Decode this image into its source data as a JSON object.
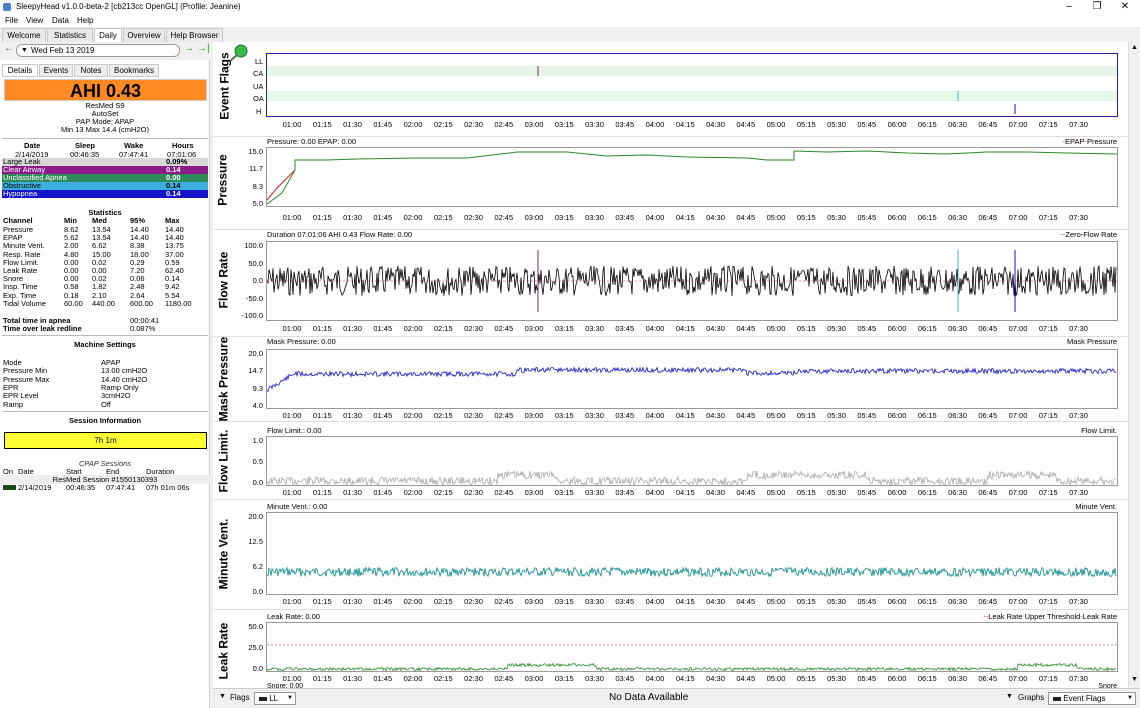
{
  "window": {
    "title": "SleepyHead v1.0.0-beta-2 [cb213cc OpenGL] (Profile: Jeanine)"
  },
  "menu": [
    "File",
    "View",
    "Data",
    "Help"
  ],
  "tabs": [
    "Welcome",
    "Statistics",
    "Daily",
    "Overview",
    "Help Browser"
  ],
  "date": "Wed Feb 13 2019",
  "subtabs": [
    "Details",
    "Events",
    "Notes",
    "Bookmarks"
  ],
  "ahi": "AHI 0.43",
  "machine": {
    "model": "ResMed S9",
    "mode_name": "AutoSet",
    "pap_mode": "PAP Mode: APAP",
    "pressure_range": "Min 13 Max 14.4 (cmH2O)"
  },
  "summary": {
    "headers": [
      "Date",
      "Sleep",
      "Wake",
      "Hours"
    ],
    "values": [
      "2/14/2019",
      "00:46:35",
      "07:47:41",
      "07:01:06"
    ]
  },
  "events": [
    {
      "name": "Large Leak",
      "value": "0.09%",
      "color": "#d8d8d8"
    },
    {
      "name": "Clear Airway",
      "value": "0.14",
      "color": "#8b1a8b"
    },
    {
      "name": "Unclassified Apnea",
      "value": "0.00",
      "color": "#2e8b57"
    },
    {
      "name": "Obstructive",
      "value": "0.14",
      "color": "#3bb0e0"
    },
    {
      "name": "Hypopnea",
      "value": "0.14",
      "color": "#1414c8"
    }
  ],
  "statistics": {
    "title": "Statistics",
    "headers": [
      "Channel",
      "Min",
      "Med",
      "95%",
      "Max"
    ],
    "rows": [
      [
        "Pressure",
        "8.62",
        "13.54",
        "14.40",
        "14.40"
      ],
      [
        "EPAP",
        "5.62",
        "13.54",
        "14.40",
        "14.40"
      ],
      [
        "Minute Vent.",
        "2.00",
        "6.62",
        "8.38",
        "13.75"
      ],
      [
        "Resp. Rate",
        "4.80",
        "15.00",
        "18.00",
        "37.00"
      ],
      [
        "Flow Limit.",
        "0.00",
        "0.02",
        "0.29",
        "0.59"
      ],
      [
        "Leak Rate",
        "0.00",
        "0.00",
        "7.20",
        "62.40"
      ],
      [
        "Snore",
        "0.00",
        "0.02",
        "0.06",
        "0.14"
      ],
      [
        "Insp. Time",
        "0.58",
        "1.82",
        "2.48",
        "9.42"
      ],
      [
        "Exp. Time",
        "0.18",
        "2.10",
        "2.64",
        "5.54"
      ],
      [
        "Tidal Volume",
        "60.00",
        "440.00",
        "600.00",
        "1180.00"
      ]
    ]
  },
  "apnea_time": {
    "label": "Total time in apnea",
    "value": "00:00:41"
  },
  "leak_time": {
    "label": "Time over leak redline",
    "value": "0.087%"
  },
  "machine_settings": {
    "title": "Machine Settings",
    "rows": [
      [
        "Mode",
        "APAP"
      ],
      [
        "Pressure Min",
        "13.00 cmH2O"
      ],
      [
        "Pressure Max",
        "14.40 cmH2O"
      ],
      [
        "EPR",
        "Ramp Only"
      ],
      [
        "EPR Level",
        "3cmH2O"
      ],
      [
        "Ramp",
        "Off"
      ]
    ]
  },
  "session_info": {
    "title": "Session Information",
    "duration": "7h 1m",
    "cpap_title": "CPAP Sessions",
    "headers": [
      "On",
      "Date",
      "Start",
      "End",
      "Duration"
    ],
    "session_name": "ResMed Session #1550130393",
    "row": [
      "2/14/2019",
      "00:46:35",
      "07:47:41",
      "07h 01m 06s"
    ]
  },
  "time_ticks": [
    "01:00",
    "01:15",
    "01:30",
    "01:45",
    "02:00",
    "02:15",
    "02:30",
    "02:45",
    "03:00",
    "03:15",
    "03:30",
    "03:45",
    "04:00",
    "04:15",
    "04:30",
    "04:45",
    "05:00",
    "05:15",
    "05:30",
    "05:45",
    "06:00",
    "06:15",
    "06:30",
    "06:45",
    "07:00",
    "07:15",
    "07:30"
  ],
  "graphs": {
    "event_flags": {
      "label": "Event Flags",
      "rows": [
        "LL",
        "CA",
        "UA",
        "OA",
        "H"
      ]
    },
    "pressure": {
      "label": "Pressure",
      "title": "Pressure: 0.00 EPAP: 0.00",
      "legend": "EPAP Pressure",
      "legend_a": "EPAP",
      "legend_b": "Pressure",
      "yticks": [
        "15.0",
        "11.7",
        "8.3",
        "5.0"
      ]
    },
    "flow_rate": {
      "label": "Flow Rate",
      "title": "Duration 07:01:06 AHI 0.43 Flow Rate: 0.00",
      "legend_a": "Zero",
      "legend_b": "Flow Rate",
      "yticks": [
        "100.0",
        "50.0",
        "0.0",
        "-50.0",
        "-100.0"
      ]
    },
    "mask_pressure": {
      "label": "Mask Pressure",
      "title": "Mask Pressure: 0.00",
      "legend": "Mask Pressure",
      "yticks": [
        "20.0",
        "14.7",
        "9.3",
        "4.0"
      ]
    },
    "flow_limit": {
      "label": "Flow Limit.",
      "title": "Flow Limit.: 0.00",
      "legend": "Flow Limit.",
      "yticks": [
        "1.0",
        "0.5",
        "0.0"
      ]
    },
    "minute_vent": {
      "label": "Minute Vent.",
      "title": "Minute Vent.: 0.00",
      "legend": "Minute Vent.",
      "yticks": [
        "20.0",
        "12.5",
        "6.2",
        "0.0"
      ]
    },
    "leak_rate": {
      "label": "Leak Rate",
      "title": "Leak Rate: 0.00",
      "legend_a": "Leak Rate Upper Threshold",
      "legend_b": "Leak Rate",
      "yticks": [
        "50.0",
        "25.0",
        "0.0"
      ]
    },
    "snore": {
      "title": "Snore: 0.00",
      "legend": "Snore"
    }
  },
  "bottom": {
    "flags": "Flags",
    "flag_select": "LL",
    "no_data": "No Data Available",
    "graphs": "Graphs",
    "graph_select": "Event Flags"
  }
}
